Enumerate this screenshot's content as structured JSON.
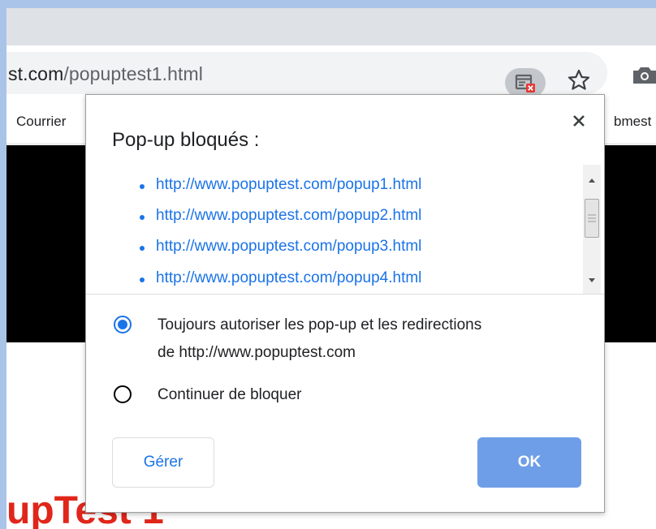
{
  "browser": {
    "url_host_partial": "st.com",
    "url_path": "/popuptest1.html",
    "bookmarks": [
      "Courrier",
      "bmest"
    ]
  },
  "page": {
    "heading_partial": "upTest 1"
  },
  "dialog": {
    "title": "Pop-up bloqués :",
    "blocked_links": [
      "http://www.popuptest.com/popup1.html",
      "http://www.popuptest.com/popup2.html",
      "http://www.popuptest.com/popup3.html",
      "http://www.popuptest.com/popup4.html"
    ],
    "options": [
      {
        "label_line1": "Toujours autoriser les pop-up et les redirections",
        "label_line2": "de http://www.popuptest.com",
        "selected": true
      },
      {
        "label_line1": "Continuer de bloquer",
        "selected": false
      }
    ],
    "manage_label": "Gérer",
    "ok_label": "OK"
  },
  "icons": {
    "popup_blocked": "popup-blocked-icon",
    "bookmark": "star-icon",
    "camera": "camera-icon",
    "close": "close-icon"
  },
  "colors": {
    "link": "#1a73e8",
    "ok_button": "#6f9ee8",
    "heading": "#e0261a",
    "badge": "#e53935"
  }
}
